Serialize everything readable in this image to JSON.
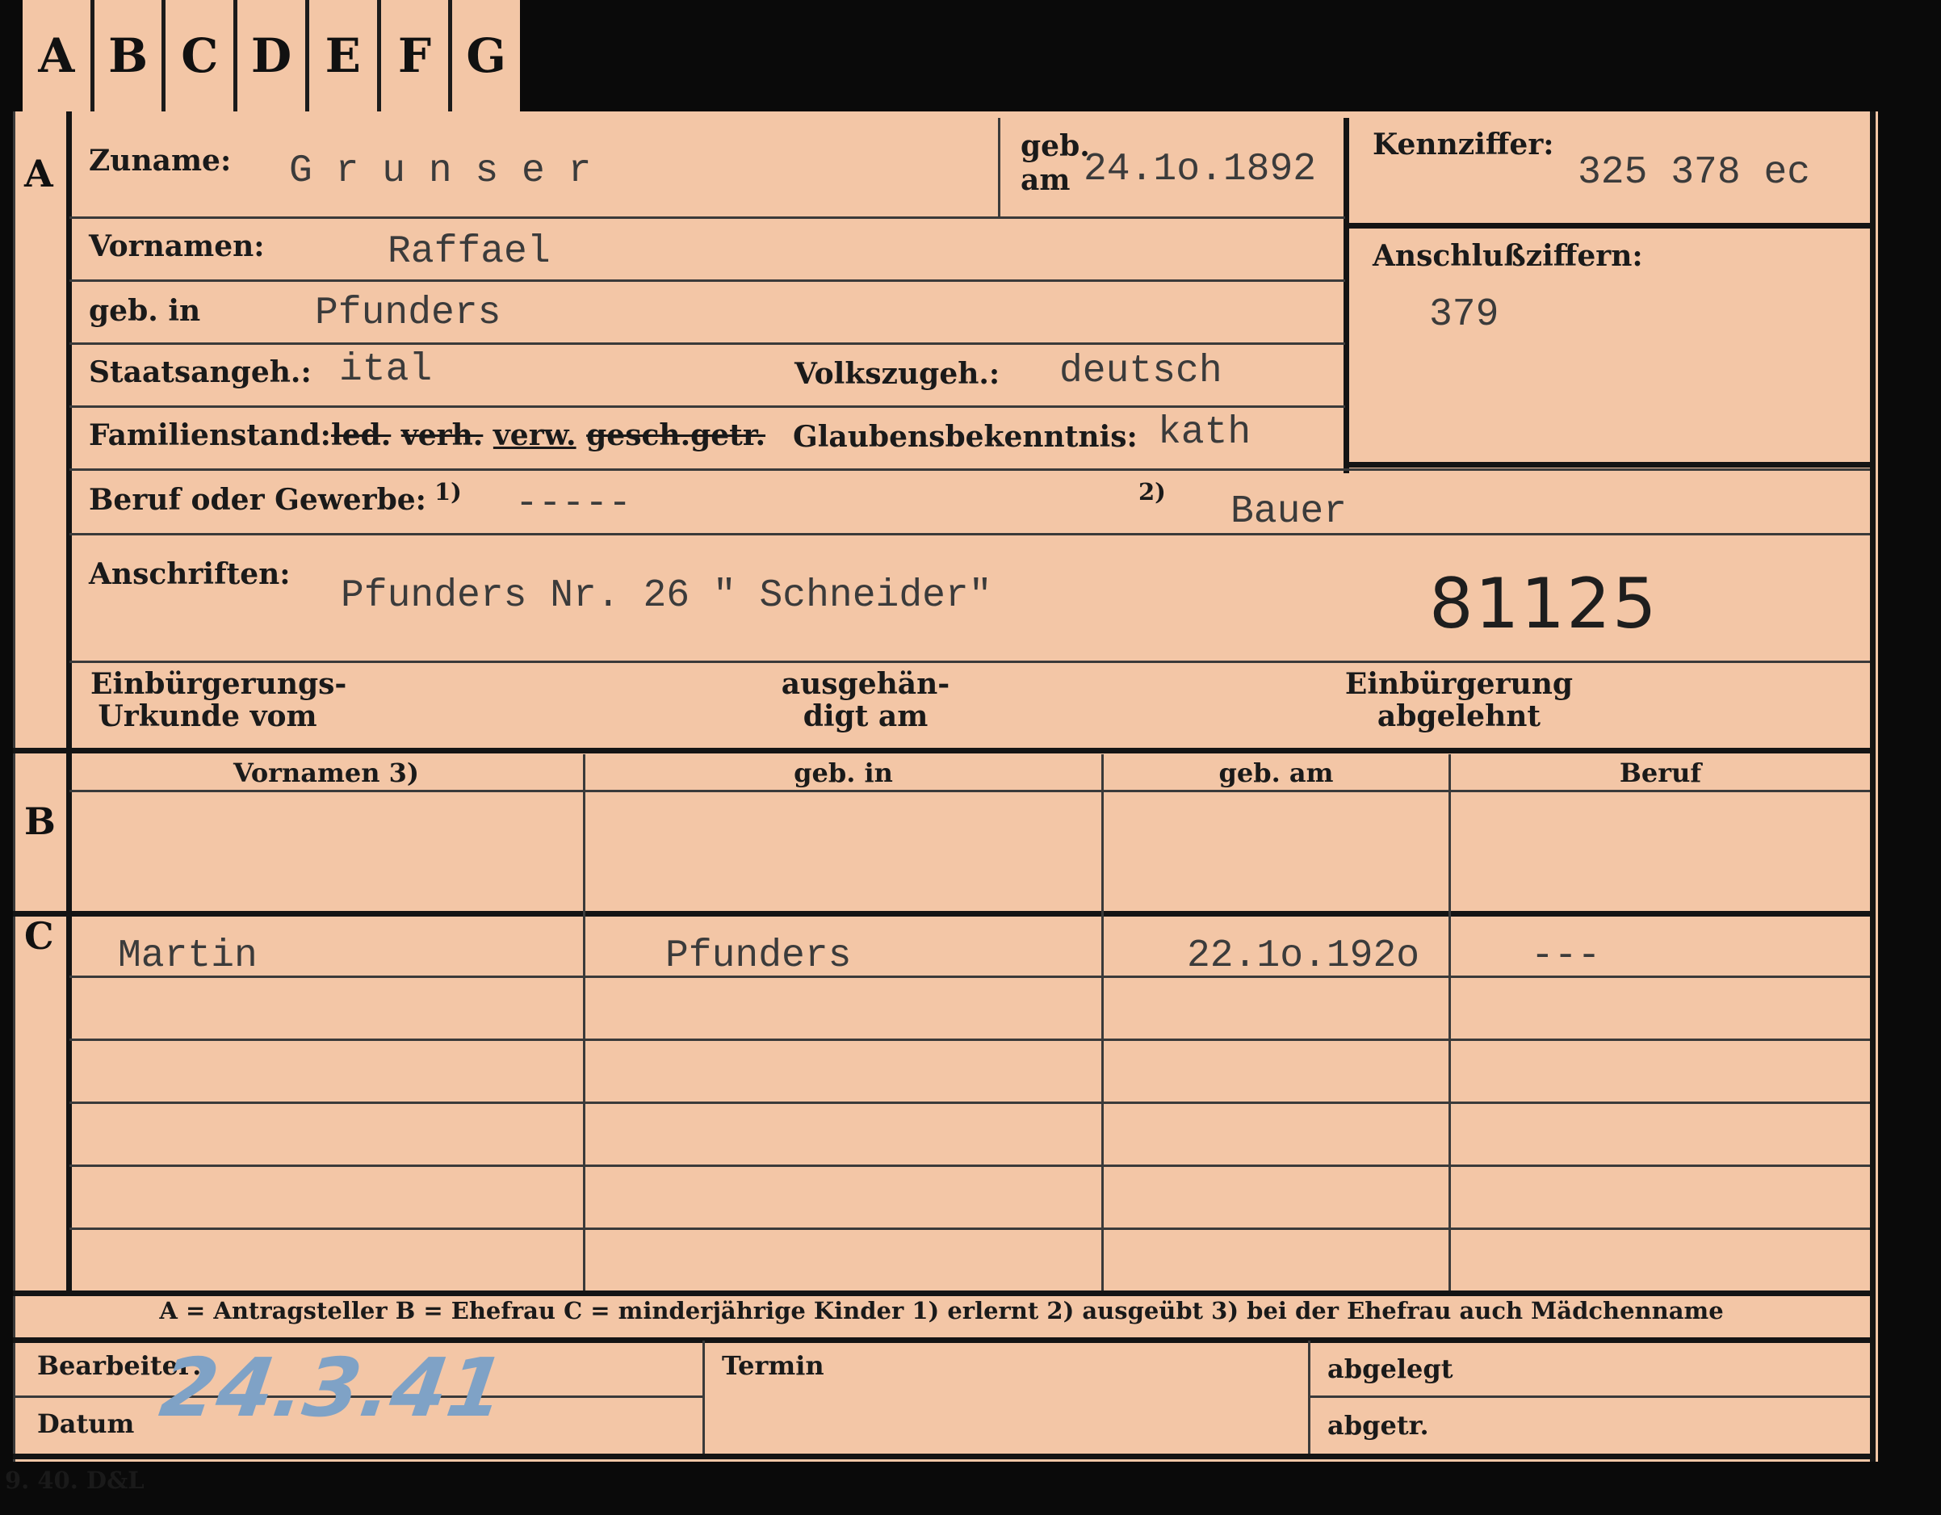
{
  "tabs": [
    "A",
    "B",
    "C",
    "D",
    "E",
    "F",
    "G"
  ],
  "section_a": {
    "marker": "A",
    "zuname_label": "Zuname:",
    "zuname_value": "G r u n s e r",
    "geb_label_1": "geb.",
    "geb_label_2": "am",
    "geb_am_value": "24.1o.1892",
    "kennziffer_label": "Kennziffer:",
    "kennziffer_value": "325 378  ec",
    "vornamen_label": "Vornamen:",
    "vornamen_value": "Raffael",
    "anschluss_label": "Anschlußziffern:",
    "anschluss_value": "379",
    "geb_in_label": "geb. in",
    "geb_in_value": "Pfunders",
    "staatsangeh_label": "Staatsangeh.:",
    "staatsangeh_value": "ital",
    "volkszugeh_label": "Volkszugeh.:",
    "volkszugeh_value": "deutsch",
    "familienstand_label": "Familienstand:",
    "familienstand_ledig": "led.",
    "familienstand_verh": "verh.",
    "familienstand_verw": "verw.",
    "familienstand_gesch": "gesch.",
    "familienstand_getr": "getr.",
    "glaubens_label": "Glaubensbekenntnis:",
    "glaubens_value": "kath",
    "beruf_label": "Beruf oder Gewerbe:",
    "beruf_mark1": "1)",
    "beruf_value1": "-----",
    "beruf_mark2": "2)",
    "beruf_value2": "Bauer",
    "anschriften_label": "Anschriften:",
    "anschriften_value": "Pfunders Nr. 26 \" Schneider\"",
    "stamp_number": "81125",
    "einb_urkunde_1": "Einbürgerungs-",
    "einb_urkunde_2": "Urkunde vom",
    "ausgehaendigt_1": "ausgehän-",
    "ausgehaendigt_2": "digt am",
    "einb_abgelehnt_1": "Einbürgerung",
    "einb_abgelehnt_2": "abgelehnt"
  },
  "section_b": {
    "marker": "B",
    "headers": [
      "Vornamen 3)",
      "geb. in",
      "geb. am",
      "Beruf"
    ]
  },
  "section_c": {
    "marker": "C",
    "rows": [
      {
        "vorname": "Martin",
        "geb_in": "Pfunders",
        "geb_am": "22.1o.192o",
        "beruf": "---"
      }
    ]
  },
  "legend": "A = Antragsteller    B = Ehefrau    C = minderjährige Kinder    1) erlernt    2) ausgeübt    3) bei der Ehefrau auch Mädchenname",
  "footer": {
    "bearbeiter_label": "Bearbeiter:",
    "datum_label": "Datum",
    "datum_value": "24.3.41",
    "termin_label": "Termin",
    "abgelegt_label": "abgelegt",
    "abgetr_label": "abgetr."
  },
  "print_mark": "9. 40. D&L"
}
